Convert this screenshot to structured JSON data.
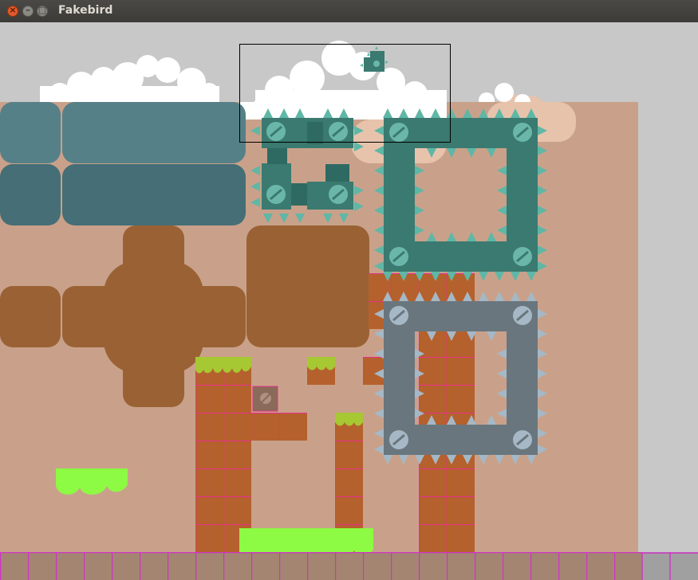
{
  "window": {
    "title": "Fakebird",
    "close_glyph": "×",
    "minimize_glyph": "–",
    "maximize_glyph": "□"
  },
  "colors": {
    "sky": "#c8c8c8",
    "level_background": "#c9a18a",
    "cloud": "#ffffff",
    "far_cloud": "#e7c3ac",
    "water_light": "#568088",
    "water_dark": "#456e76",
    "dirt_blob": "#9a6234",
    "brick": "#b5612d",
    "brick_grid": "#e8308c",
    "grass": "#a6c832",
    "slime": "#8dfa43",
    "teal_block": "#3a7a70",
    "teal_screw": "#6ab7a9",
    "teal_spike": "#5fb7a6",
    "grey_block": "#69767e",
    "grey_spike": "#a5b8c6",
    "floor_tile": "#a48571",
    "floor_grid": "#d032c8",
    "viewport_outline": "#000000"
  },
  "icons": [
    "screw-icon",
    "spike-icon",
    "cloud-icon",
    "slime-icon",
    "player-snake-icon",
    "fruit-icon"
  ]
}
